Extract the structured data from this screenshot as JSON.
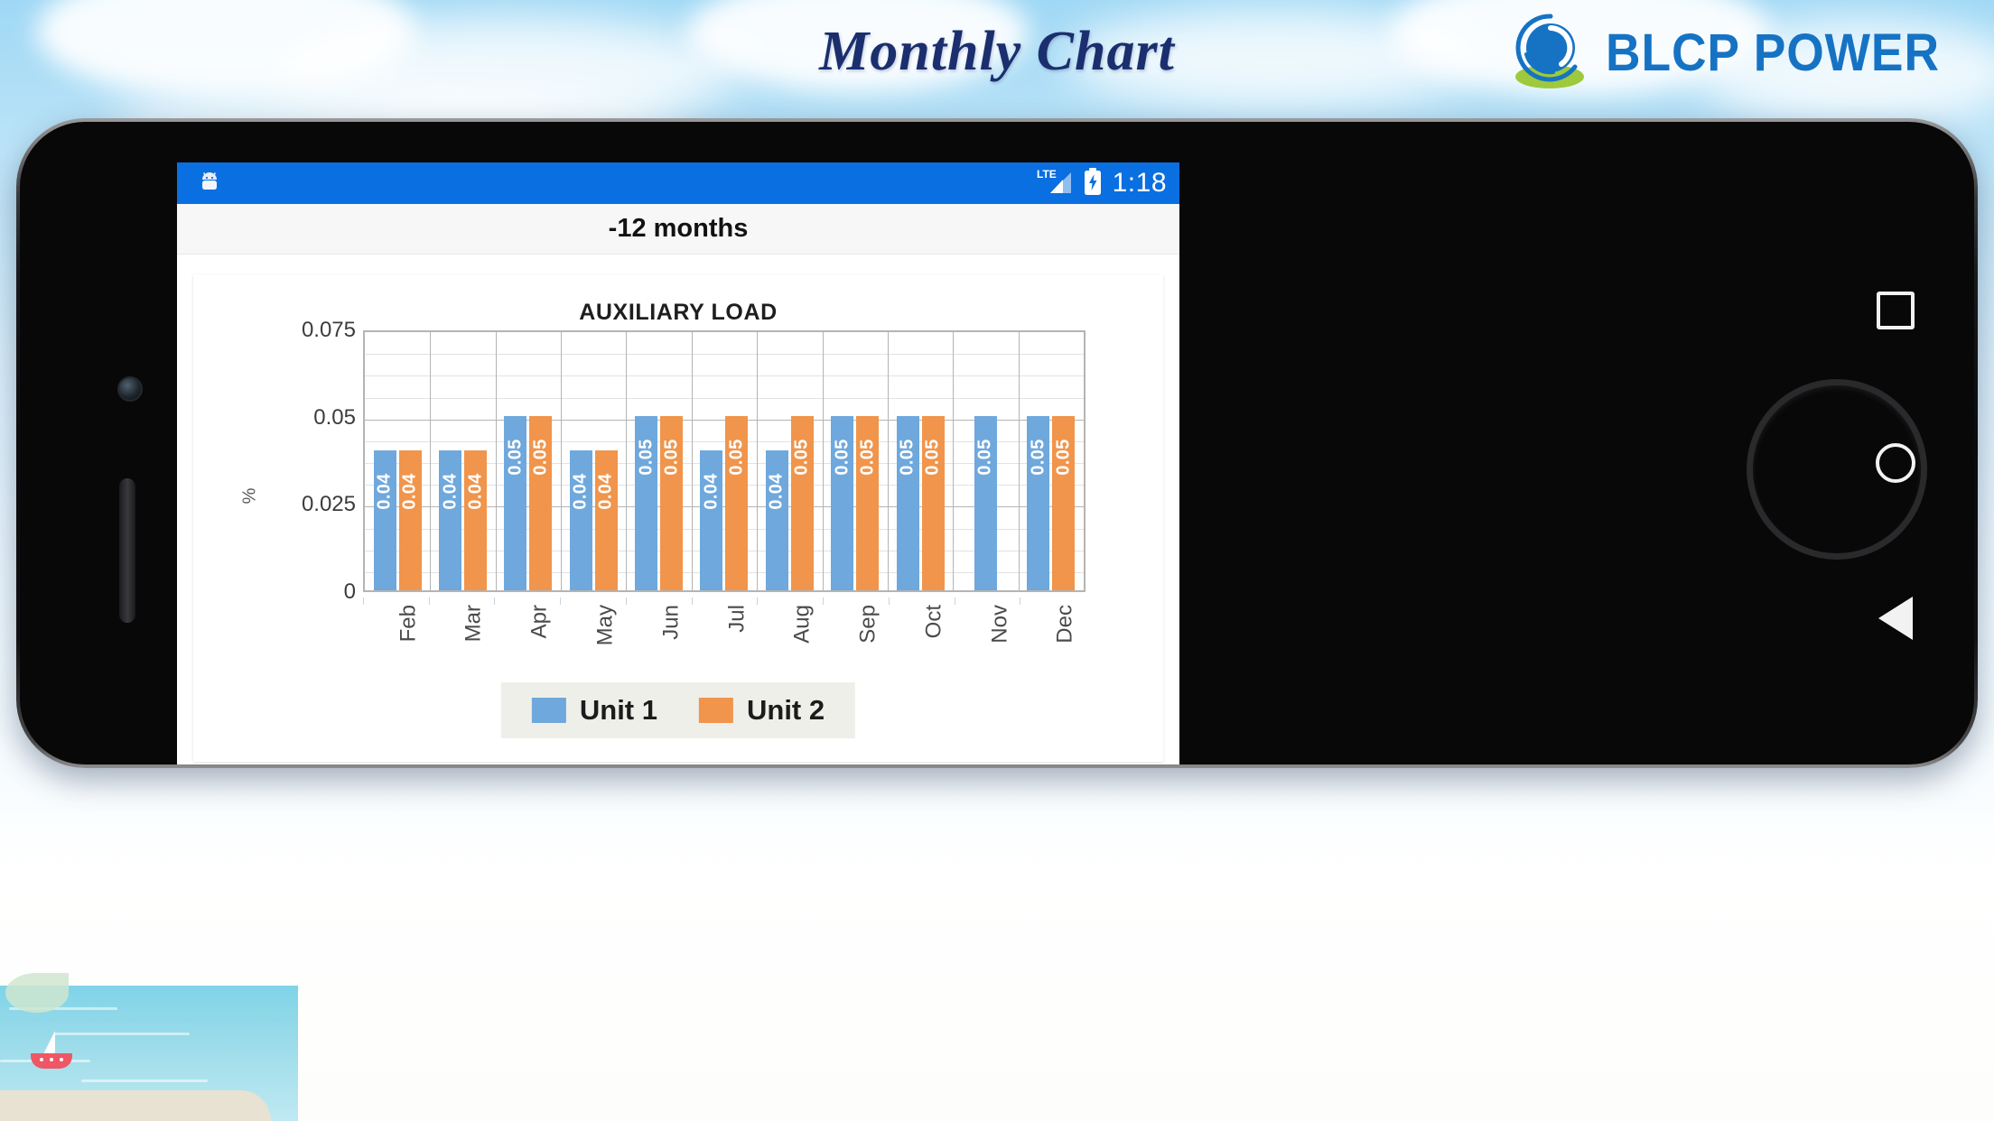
{
  "page": {
    "title": "Monthly Chart",
    "logo_text": "BLCP POWER",
    "logo_brand_color": "#1673c4",
    "logo_accent_color": "#9ec93c",
    "title_color": "#1b2f6e"
  },
  "phone": {
    "status_bar": {
      "network_label": "LTE",
      "time": "1:18",
      "background_color": "#0a6fe0",
      "app_icon": "android-icon",
      "signal_icon": "signal-bars-icon",
      "battery_icon": "battery-charging-icon"
    },
    "app_bar": {
      "title": "-12 months"
    },
    "nav": {
      "recents_label": "Recents",
      "home_label": "Home",
      "back_label": "Back"
    }
  },
  "chart_data": {
    "type": "bar",
    "title": "AUXILIARY LOAD",
    "xlabel": "",
    "ylabel": "%",
    "ylim": [
      0,
      0.075
    ],
    "yticks": [
      "0.075",
      "0.05",
      "0.025",
      "0"
    ],
    "ytick_values": [
      0.075,
      0.05,
      0.025,
      0
    ],
    "grid": true,
    "legend_position": "bottom",
    "categories": [
      "Feb",
      "Mar",
      "Apr",
      "May",
      "Jun",
      "Jul",
      "Aug",
      "Sep",
      "Oct",
      "Nov",
      "Dec"
    ],
    "series": [
      {
        "name": "Unit 1",
        "color": "#6fa8dc",
        "values": [
          0.04,
          0.04,
          0.05,
          0.04,
          0.05,
          0.04,
          0.04,
          0.05,
          0.05,
          0.05,
          0.05
        ],
        "labels": [
          "0.04",
          "0.04",
          "0.05",
          "0.04",
          "0.05",
          "0.04",
          "0.04",
          "0.05",
          "0.05",
          "0.05",
          "0.05"
        ]
      },
      {
        "name": "Unit 2",
        "color": "#f0954b",
        "values": [
          0.04,
          0.04,
          0.05,
          0.04,
          0.05,
          0.05,
          0.05,
          0.05,
          0.05,
          null,
          0.05
        ],
        "labels": [
          "0.04",
          "0.04",
          "0.05",
          "0.04",
          "0.05",
          "0.05",
          "0.05",
          "0.05",
          "0.05",
          "",
          "0.05"
        ]
      }
    ],
    "legend": [
      {
        "label": "Unit 1",
        "color": "#6fa8dc"
      },
      {
        "label": "Unit 2",
        "color": "#f0954b"
      }
    ]
  }
}
